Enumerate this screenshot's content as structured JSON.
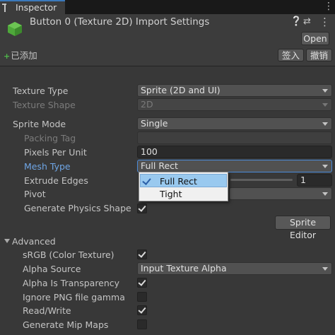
{
  "tab": {
    "label": "Inspector"
  },
  "header": {
    "title": "Button 0 (Texture 2D) Import Settings",
    "open_label": "Open",
    "added_label": "已添加",
    "checkin_label": "签入",
    "undo_label": "撤销"
  },
  "props": {
    "texture_type": {
      "label": "Texture Type",
      "value": "Sprite (2D and UI)"
    },
    "texture_shape": {
      "label": "Texture Shape",
      "value": "2D"
    },
    "sprite_mode": {
      "label": "Sprite Mode",
      "value": "Single"
    },
    "packing_tag": {
      "label": "Packing Tag",
      "value": ""
    },
    "pixels_per_unit": {
      "label": "Pixels Per Unit",
      "value": "100"
    },
    "mesh_type": {
      "label": "Mesh Type",
      "value": "Full Rect"
    },
    "extrude_edges": {
      "label": "Extrude Edges",
      "value": "1"
    },
    "pivot": {
      "label": "Pivot"
    },
    "generate_physics_shape": {
      "label": "Generate Physics Shape",
      "checked": true
    },
    "sprite_editor_label": "Sprite Editor"
  },
  "mesh_popup": {
    "options": [
      "Full Rect",
      "Tight"
    ],
    "selected": "Full Rect"
  },
  "advanced": {
    "label": "Advanced",
    "srgb": {
      "label": "sRGB (Color Texture)",
      "checked": true
    },
    "alpha_source": {
      "label": "Alpha Source",
      "value": "Input Texture Alpha"
    },
    "alpha_transparency": {
      "label": "Alpha Is Transparency",
      "checked": true
    },
    "ignore_png_gamma": {
      "label": "Ignore PNG file gamma",
      "checked": false
    },
    "read_write": {
      "label": "Read/Write",
      "checked": true
    },
    "generate_mip_maps": {
      "label": "Generate Mip Maps",
      "checked": false
    }
  },
  "colors": {
    "accent": "#3a79bb",
    "highlight_label": "#6fa6e6",
    "popup_selection": "#99c9ef",
    "cube_green": "#4ea83a"
  }
}
